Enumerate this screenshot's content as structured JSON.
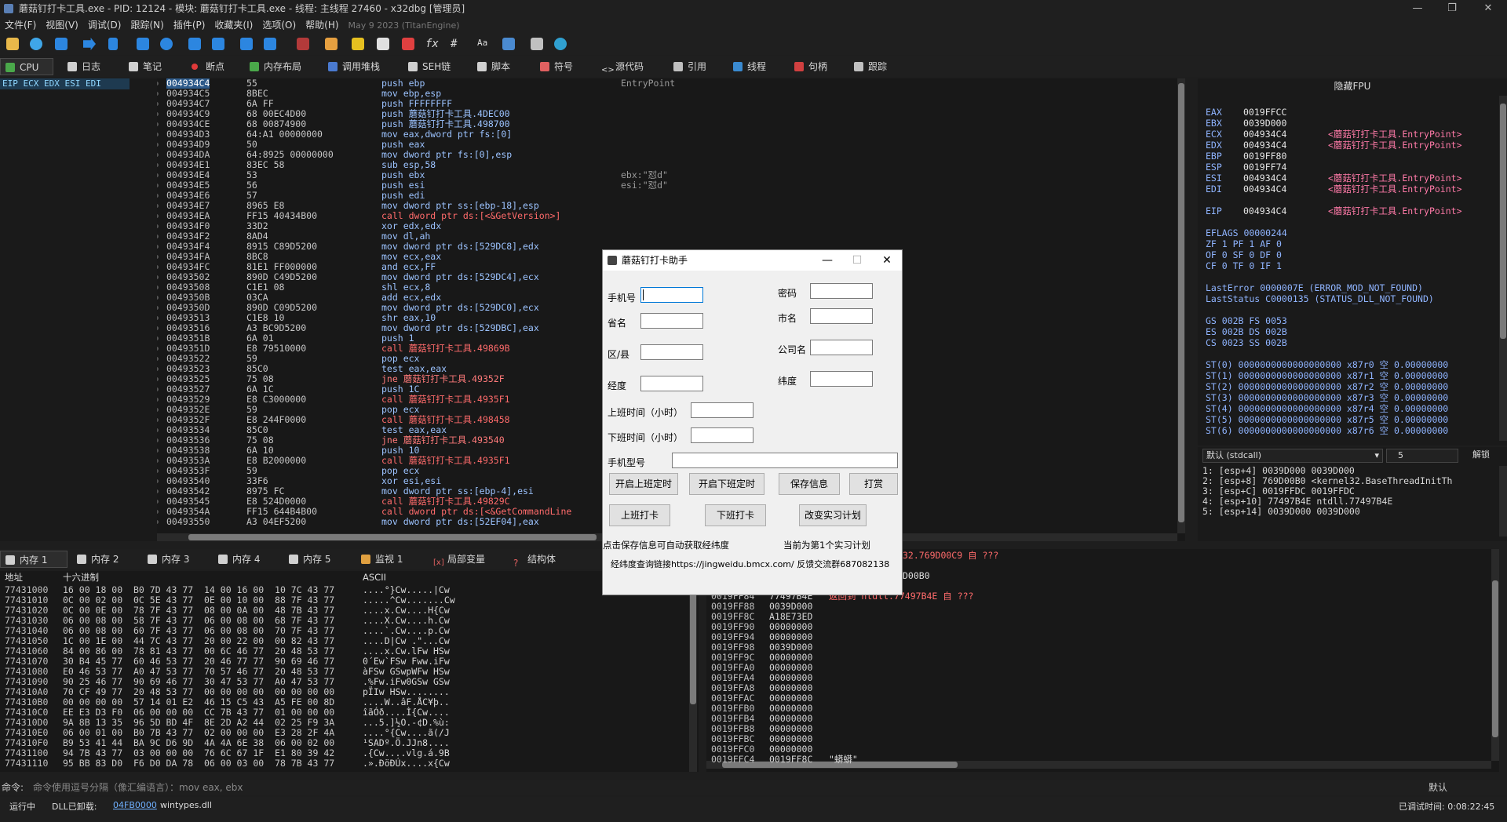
{
  "window": {
    "title": "蘑菇钉打卡工具.exe - PID: 12124 - 模块: 蘑菇钉打卡工具.exe - 线程: 主线程 27460 - x32dbg [管理员]"
  },
  "menu": {
    "items": [
      "文件(F)",
      "视图(V)",
      "调试(D)",
      "跟踪(N)",
      "插件(P)",
      "收藏夹(I)",
      "选项(O)",
      "帮助(H)"
    ],
    "build": "May 9 2023 (TitanEngine)"
  },
  "tabs": [
    "CPU",
    "日志",
    "笔记",
    "断点",
    "内存布局",
    "调用堆栈",
    "SEH链",
    "脚本",
    "符号",
    "源代码",
    "引用",
    "线程",
    "句柄",
    "跟踪"
  ],
  "regbar": "EIP ECX EDX ESI EDI",
  "disasm": [
    {
      "addr": "004934C4",
      "bytes": "55",
      "ins": "push ebp",
      "cmt": "EntryPoint",
      "kind": "n"
    },
    {
      "addr": "004934C5",
      "bytes": "8BEC",
      "ins": "mov ebp,esp",
      "cmt": "",
      "kind": "n"
    },
    {
      "addr": "004934C7",
      "bytes": "6A FF",
      "ins": "push FFFFFFFF",
      "cmt": "",
      "kind": "n"
    },
    {
      "addr": "004934C9",
      "bytes": "68 00EC4D00",
      "ins": "push 蘑菇钉打卡工具.4DEC00",
      "cmt": "",
      "kind": "n"
    },
    {
      "addr": "004934CE",
      "bytes": "68 00874900",
      "ins": "push 蘑菇钉打卡工具.498700",
      "cmt": "",
      "kind": "n"
    },
    {
      "addr": "004934D3",
      "bytes": "64:A1 00000000",
      "ins": "mov eax,dword ptr fs:[0]",
      "cmt": "",
      "kind": "n"
    },
    {
      "addr": "004934D9",
      "bytes": "50",
      "ins": "push eax",
      "cmt": "",
      "kind": "n"
    },
    {
      "addr": "004934DA",
      "bytes": "64:8925 00000000",
      "ins": "mov dword ptr fs:[0],esp",
      "cmt": "",
      "kind": "n"
    },
    {
      "addr": "004934E1",
      "bytes": "83EC 58",
      "ins": "sub esp,58",
      "cmt": "",
      "kind": "n"
    },
    {
      "addr": "004934E4",
      "bytes": "53",
      "ins": "push ebx",
      "cmt": "ebx:\"怼d\"",
      "kind": "n"
    },
    {
      "addr": "004934E5",
      "bytes": "56",
      "ins": "push esi",
      "cmt": "esi:\"怼d\"",
      "kind": "n"
    },
    {
      "addr": "004934E6",
      "bytes": "57",
      "ins": "push edi",
      "cmt": "",
      "kind": "n"
    },
    {
      "addr": "004934E7",
      "bytes": "8965 E8",
      "ins": "mov dword ptr ss:[ebp-18],esp",
      "cmt": "",
      "kind": "n"
    },
    {
      "addr": "004934EA",
      "bytes": "FF15 40434B00",
      "ins": "call dword ptr ds:[<&GetVersion>]",
      "cmt": "",
      "kind": "c"
    },
    {
      "addr": "004934F0",
      "bytes": "33D2",
      "ins": "xor edx,edx",
      "cmt": "",
      "kind": "n"
    },
    {
      "addr": "004934F2",
      "bytes": "8AD4",
      "ins": "mov dl,ah",
      "cmt": "",
      "kind": "n"
    },
    {
      "addr": "004934F4",
      "bytes": "8915 C89D5200",
      "ins": "mov dword ptr ds:[529DC8],edx",
      "cmt": "",
      "kind": "n"
    },
    {
      "addr": "004934FA",
      "bytes": "8BC8",
      "ins": "mov ecx,eax",
      "cmt": "",
      "kind": "n"
    },
    {
      "addr": "004934FC",
      "bytes": "81E1 FF000000",
      "ins": "and ecx,FF",
      "cmt": "",
      "kind": "n"
    },
    {
      "addr": "00493502",
      "bytes": "890D C49D5200",
      "ins": "mov dword ptr ds:[529DC4],ecx",
      "cmt": "",
      "kind": "n"
    },
    {
      "addr": "00493508",
      "bytes": "C1E1 08",
      "ins": "shl ecx,8",
      "cmt": "",
      "kind": "n"
    },
    {
      "addr": "0049350B",
      "bytes": "03CA",
      "ins": "add ecx,edx",
      "cmt": "",
      "kind": "n"
    },
    {
      "addr": "0049350D",
      "bytes": "890D C09D5200",
      "ins": "mov dword ptr ds:[529DC0],ecx",
      "cmt": "",
      "kind": "n"
    },
    {
      "addr": "00493513",
      "bytes": "C1E8 10",
      "ins": "shr eax,10",
      "cmt": "",
      "kind": "n"
    },
    {
      "addr": "00493516",
      "bytes": "A3 BC9D5200",
      "ins": "mov dword ptr ds:[529DBC],eax",
      "cmt": "",
      "kind": "n"
    },
    {
      "addr": "0049351B",
      "bytes": "6A 01",
      "ins": "push 1",
      "cmt": "",
      "kind": "n"
    },
    {
      "addr": "0049351D",
      "bytes": "E8 79510000",
      "ins": "call 蘑菇钉打卡工具.49869B",
      "cmt": "",
      "kind": "c"
    },
    {
      "addr": "00493522",
      "bytes": "59",
      "ins": "pop ecx",
      "cmt": "",
      "kind": "n"
    },
    {
      "addr": "00493523",
      "bytes": "85C0",
      "ins": "test eax,eax",
      "cmt": "",
      "kind": "n"
    },
    {
      "addr": "00493525",
      "bytes": "75 08",
      "ins": "jne 蘑菇钉打卡工具.49352F",
      "cmt": "",
      "kind": "j"
    },
    {
      "addr": "00493527",
      "bytes": "6A 1C",
      "ins": "push 1C",
      "cmt": "",
      "kind": "n"
    },
    {
      "addr": "00493529",
      "bytes": "E8 C3000000",
      "ins": "call 蘑菇钉打卡工具.4935F1",
      "cmt": "",
      "kind": "c"
    },
    {
      "addr": "0049352E",
      "bytes": "59",
      "ins": "pop ecx",
      "cmt": "",
      "kind": "n"
    },
    {
      "addr": "0049352F",
      "bytes": "E8 244F0000",
      "ins": "call 蘑菇钉打卡工具.498458",
      "cmt": "",
      "kind": "c"
    },
    {
      "addr": "00493534",
      "bytes": "85C0",
      "ins": "test eax,eax",
      "cmt": "",
      "kind": "n"
    },
    {
      "addr": "00493536",
      "bytes": "75 08",
      "ins": "jne 蘑菇钉打卡工具.493540",
      "cmt": "",
      "kind": "j"
    },
    {
      "addr": "00493538",
      "bytes": "6A 10",
      "ins": "push 10",
      "cmt": "",
      "kind": "n"
    },
    {
      "addr": "0049353A",
      "bytes": "E8 B2000000",
      "ins": "call 蘑菇钉打卡工具.4935F1",
      "cmt": "",
      "kind": "c"
    },
    {
      "addr": "0049353F",
      "bytes": "59",
      "ins": "pop ecx",
      "cmt": "",
      "kind": "n"
    },
    {
      "addr": "00493540",
      "bytes": "33F6",
      "ins": "xor esi,esi",
      "cmt": "",
      "kind": "n"
    },
    {
      "addr": "00493542",
      "bytes": "8975 FC",
      "ins": "mov dword ptr ss:[ebp-4],esi",
      "cmt": "",
      "kind": "n"
    },
    {
      "addr": "00493545",
      "bytes": "E8 524D0000",
      "ins": "call 蘑菇钉打卡工具.49829C",
      "cmt": "",
      "kind": "c"
    },
    {
      "addr": "0049354A",
      "bytes": "FF15 644B4B00",
      "ins": "call dword ptr ds:[<&GetCommandLine",
      "cmt": "",
      "kind": "c"
    },
    {
      "addr": "00493550",
      "bytes": "A3 04EF5200",
      "ins": "mov dword ptr ds:[52EF04],eax",
      "cmt": "",
      "kind": "n"
    }
  ],
  "regs": {
    "header": "隐藏FPU",
    "gp": [
      {
        "n": "EAX",
        "v": "0019FFCC",
        "s": ""
      },
      {
        "n": "EBX",
        "v": "0039D000",
        "s": ""
      },
      {
        "n": "ECX",
        "v": "004934C4",
        "s": "<蘑菇钉打卡工具.EntryPoint>"
      },
      {
        "n": "EDX",
        "v": "004934C4",
        "s": "<蘑菇钉打卡工具.EntryPoint>"
      },
      {
        "n": "EBP",
        "v": "0019FF80",
        "s": ""
      },
      {
        "n": "ESP",
        "v": "0019FF74",
        "s": ""
      },
      {
        "n": "ESI",
        "v": "004934C4",
        "s": "<蘑菇钉打卡工具.EntryPoint>"
      },
      {
        "n": "EDI",
        "v": "004934C4",
        "s": "<蘑菇钉打卡工具.EntryPoint>"
      }
    ],
    "eip": {
      "n": "EIP",
      "v": "004934C4",
      "s": "<蘑菇钉打卡工具.EntryPoint>"
    },
    "eflags": "EFLAGS   00000244",
    "flags": [
      "ZF 1  PF 1  AF 0",
      "OF 0  SF 0  DF 0",
      "CF 0  TF 0  IF 1"
    ],
    "lasterror": "LastError  0000007E (ERROR_MOD_NOT_FOUND)",
    "laststatus": "LastStatus C0000135 (STATUS_DLL_NOT_FOUND)",
    "segs": [
      "GS 002B  FS 0053",
      "ES 002B  DS 002B",
      "CS 0023  SS 002B"
    ],
    "st": [
      "ST(0) 0000000000000000000 x87r0 空 0.00000000",
      "ST(1) 0000000000000000000 x87r1 空 0.00000000",
      "ST(2) 0000000000000000000 x87r2 空 0.00000000",
      "ST(3) 0000000000000000000 x87r3 空 0.00000000",
      "ST(4) 0000000000000000000 x87r4 空 0.00000000",
      "ST(5) 0000000000000000000 x87r5 空 0.00000000",
      "ST(6) 0000000000000000000 x87r6 空 0.00000000"
    ]
  },
  "callconv": {
    "label": "默认 (stdcall)",
    "count": "5",
    "unlock": "解锁"
  },
  "args": [
    "1: [esp+4] 0039D000 0039D000",
    "2: [esp+8] 769D00B0 <kernel32.BaseThreadInitTh",
    "3: [esp+C] 0019FFDC 0019FFDC",
    "4: [esp+10] 77497B4E ntdll.77497B4E",
    "5: [esp+14] 0039D000 0039D000"
  ],
  "bottomtabs": [
    "内存 1",
    "内存 2",
    "内存 3",
    "内存 4",
    "内存 5",
    "监视 1",
    "局部变量",
    "结构体"
  ],
  "dump": {
    "col_addr": "地址",
    "col_hex": "十六进制",
    "col_ascii": "ASCII",
    "rows": [
      {
        "a": "77431000",
        "h": "16 00 18 00  B0 7D 43 77  14 00 16 00  10 7C 43 77",
        "s": "....°}Cw.....|Cw"
      },
      {
        "a": "77431010",
        "h": "0C 00 02 00  0C 5E 43 77  0E 00 10 00  88 7F 43 77",
        "s": ".....^Cw.......Cw"
      },
      {
        "a": "77431020",
        "h": "0C 00 0E 00  78 7F 43 77  08 00 0A 00  48 7B 43 77",
        "s": "....x.Cw....H{Cw"
      },
      {
        "a": "77431030",
        "h": "06 00 08 00  58 7F 43 77  06 00 08 00  68 7F 43 77",
        "s": "....X.Cw....h.Cw"
      },
      {
        "a": "77431040",
        "h": "06 00 08 00  60 7F 43 77  06 00 08 00  70 7F 43 77",
        "s": "....`.Cw....p.Cw"
      },
      {
        "a": "77431050",
        "h": "1C 00 1E 00  44 7C 43 77  20 00 22 00  00 82 43 77",
        "s": "....D|Cw .\"...Cw"
      },
      {
        "a": "77431060",
        "h": "84 00 86 00  78 81 43 77  00 6C 46 77  20 48 53 77",
        "s": "....x.Cw.lFw HSw"
      },
      {
        "a": "77431070",
        "h": "30 B4 45 77  60 46 53 77  20 46 77 77  90 69 46 77",
        "s": "0´Ew`FSw Fww.iFw"
      },
      {
        "a": "77431080",
        "h": "E0 46 53 77  A0 47 53 77  70 57 46 77  20 48 53 77",
        "s": "àFSw GSwpWFw HSw"
      },
      {
        "a": "77431090",
        "h": "90 25 46 77  90 69 46 77  30 47 53 77  A0 47 53 77",
        "s": ".%Fw.iFw0GSw GSw"
      },
      {
        "a": "774310A0",
        "h": "70 CF 49 77  20 48 53 77  00 00 00 00  00 00 00 00",
        "s": "pÏIw HSw........"
      },
      {
        "a": "774310B0",
        "h": "00 00 00 00  57 14 01 E2  46 15 C5 43  A5 FE 00 8D",
        "s": "....W..âF.ÅC¥þ.."
      },
      {
        "a": "774310C0",
        "h": "EE E3 D3 F0  06 00 00 00  CC 7B 43 77  01 00 00 00",
        "s": "îãÓð....Ì{Cw...."
      },
      {
        "a": "774310D0",
        "h": "9A 8B 13 35  96 5D BD 4F  8E 2D A2 44  02 25 F9 3A",
        "s": "...5.]½O.-¢D.%ù:"
      },
      {
        "a": "774310E0",
        "h": "06 00 01 00  B0 7B 43 77  02 00 00 00  E3 28 2F 4A",
        "s": "....°{Cw....ã(/J"
      },
      {
        "a": "774310F0",
        "h": "B9 53 41 44  BA 9C D6 9D  4A 4A 6E 38  06 00 02 00",
        "s": "¹SADº.Ö.JJn8...."
      },
      {
        "a": "77431100",
        "h": "94 7B 43 77  03 00 00 00  76 6C 67 1F  E1 80 39 42",
        "s": ".{Cw....vlg.á.9B"
      },
      {
        "a": "77431110",
        "h": "95 BB 83 D0  F6 D0 DA 78  06 00 03 00  78 7B 43 77",
        "s": ".».ÐöÐÚx....x{Cw"
      }
    ]
  },
  "stack": {
    "topline1": "32.769D00C9 自 ???",
    "topline2": "D00B0",
    "retline": "返回到 ntdll.77497B4E 自 ???",
    "rows": [
      {
        "a": "0019FF84",
        "v": "77497B4E"
      },
      {
        "a": "0019FF88",
        "v": "0039D000"
      },
      {
        "a": "0019FF8C",
        "v": "A18E73ED"
      },
      {
        "a": "0019FF90",
        "v": "00000000"
      },
      {
        "a": "0019FF94",
        "v": "00000000"
      },
      {
        "a": "0019FF98",
        "v": "0039D000"
      },
      {
        "a": "0019FF9C",
        "v": "00000000"
      },
      {
        "a": "0019FFA0",
        "v": "00000000"
      },
      {
        "a": "0019FFA4",
        "v": "00000000"
      },
      {
        "a": "0019FFA8",
        "v": "00000000"
      },
      {
        "a": "0019FFAC",
        "v": "00000000"
      },
      {
        "a": "0019FFB0",
        "v": "00000000"
      },
      {
        "a": "0019FFB4",
        "v": "00000000"
      },
      {
        "a": "0019FFB8",
        "v": "00000000"
      },
      {
        "a": "0019FFBC",
        "v": "00000000"
      },
      {
        "a": "0019FFC0",
        "v": "00000000"
      },
      {
        "a": "0019FFC4",
        "v": "0019FF8C"
      }
    ],
    "lastcmt": "\"蟒蟒\""
  },
  "cmd": {
    "label": "命令:",
    "placeholder": "命令使用逗号分隔（像汇编语言）：mov eax, ebx",
    "right": "默认"
  },
  "status": {
    "state": "运行中",
    "dll": "DLL已卸载:",
    "dlladdr": "04FB0000",
    "dllname": "wintypes.dll",
    "time": "已调试时间:  0:08:22:45"
  },
  "dialog": {
    "title": "蘑菇钉打卡助手",
    "labels": {
      "phone": "手机号",
      "password": "密码",
      "province": "省名",
      "city": "市名",
      "district": "区/县",
      "company": "公司名",
      "longitude": "经度",
      "latitude": "纬度",
      "start": "上班时间（小时）",
      "end": "下班时间（小时）",
      "model": "手机型号"
    },
    "buttons": {
      "start_on": "开启上班定时",
      "end_on": "开启下班定时",
      "save": "保存信息",
      "tip": "打赏",
      "clock_in": "上班打卡",
      "clock_out": "下班打卡",
      "change_plan": "改变实习计划"
    },
    "info_left": "点击保存信息可自动获取经纬度",
    "info_right": "当前为第1个实习计划",
    "link": "经纬度查询链接https://jingweidu.bmcx.com/ 反馈交流群687082138"
  }
}
